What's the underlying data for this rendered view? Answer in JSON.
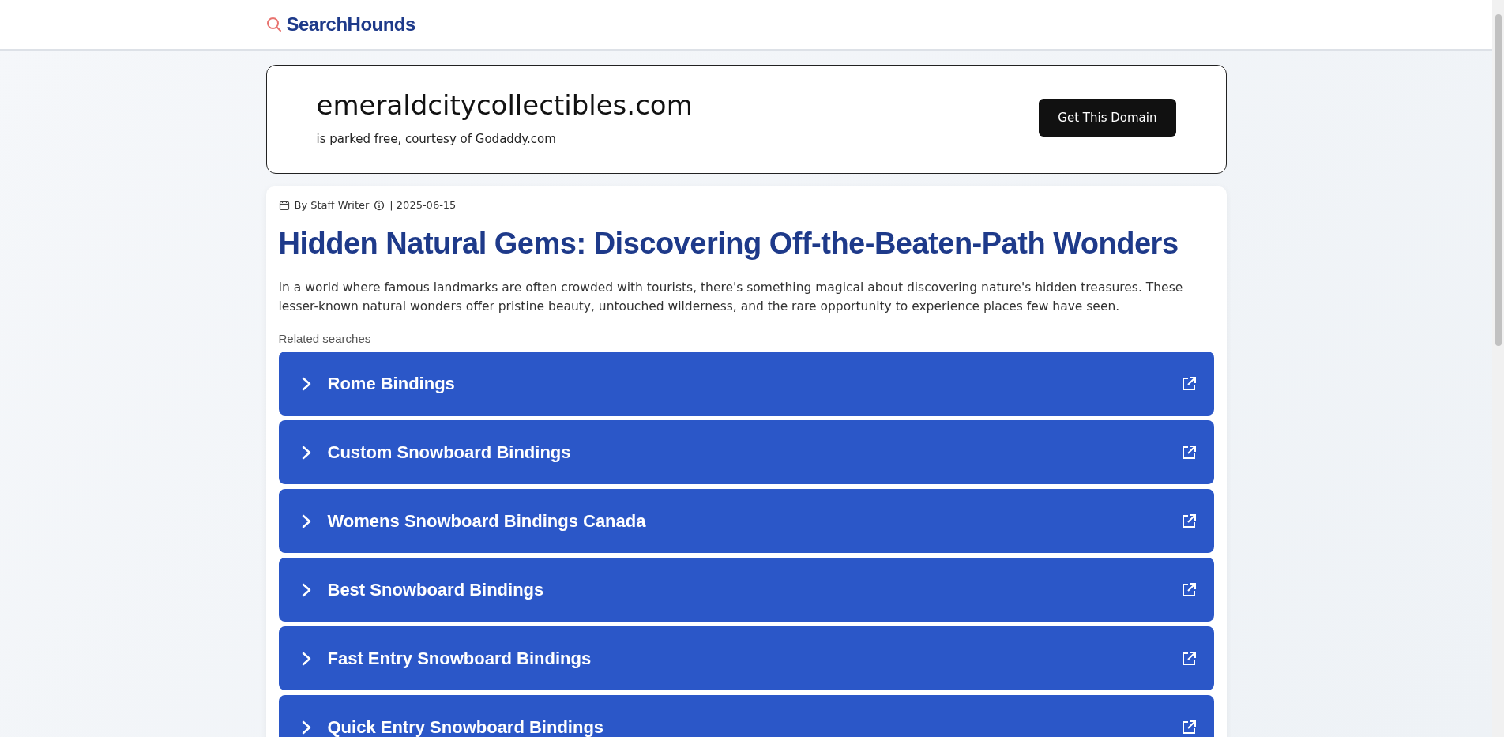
{
  "header": {
    "logo": "SearchHounds"
  },
  "domain_banner": {
    "domain": "emeraldcitycollectibles.com",
    "subtitle": "is parked free, courtesy of Godaddy.com",
    "button": "Get This Domain"
  },
  "article": {
    "byline": "By Staff Writer",
    "date": "| 2025-06-15",
    "title": "Hidden Natural Gems: Discovering Off-the-Beaten-Path Wonders",
    "intro": "In a world where famous landmarks are often crowded with tourists, there's something magical about discovering nature's hidden treasures. These lesser-known natural wonders offer pristine beauty, untouched wilderness, and the rare opportunity to experience places few have seen."
  },
  "related_searches": {
    "label": "Related searches",
    "items": [
      {
        "label": "Rome Bindings"
      },
      {
        "label": "Custom Snowboard Bindings"
      },
      {
        "label": "Womens Snowboard Bindings Canada"
      },
      {
        "label": "Best Snowboard Bindings"
      },
      {
        "label": "Fast Entry Snowboard Bindings"
      },
      {
        "label": "Quick Entry Snowboard Bindings"
      }
    ]
  }
}
